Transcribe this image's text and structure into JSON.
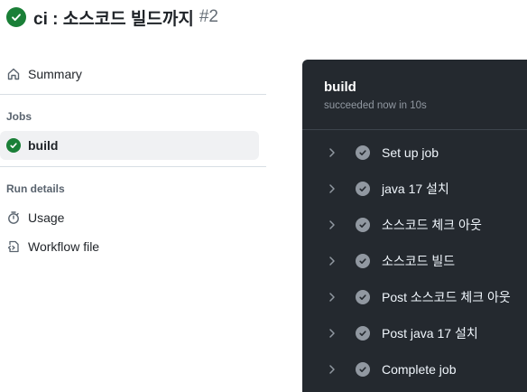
{
  "header": {
    "title": "ci : 소스코드 빌드까지",
    "run_number": "#2",
    "status_icon": "success-check-icon",
    "status_color": "#1a7f37"
  },
  "sidebar": {
    "summary_label": "Summary",
    "jobs_heading": "Jobs",
    "jobs": [
      {
        "label": "build",
        "status": "success"
      }
    ],
    "run_details_heading": "Run details",
    "run_details": [
      {
        "label": "Usage",
        "icon": "stopwatch-icon"
      },
      {
        "label": "Workflow file",
        "icon": "file-code-icon"
      }
    ]
  },
  "log_panel": {
    "job_title": "build",
    "job_status": "succeeded now in 10s",
    "background": "#24292f",
    "steps": [
      {
        "label": "Set up job"
      },
      {
        "label": "java 17 설치"
      },
      {
        "label": "소스코드 체크 아웃"
      },
      {
        "label": "소스코드 빌드"
      },
      {
        "label": "Post 소스코드 체크 아웃"
      },
      {
        "label": "Post java 17 설치"
      },
      {
        "label": "Complete job"
      }
    ]
  }
}
